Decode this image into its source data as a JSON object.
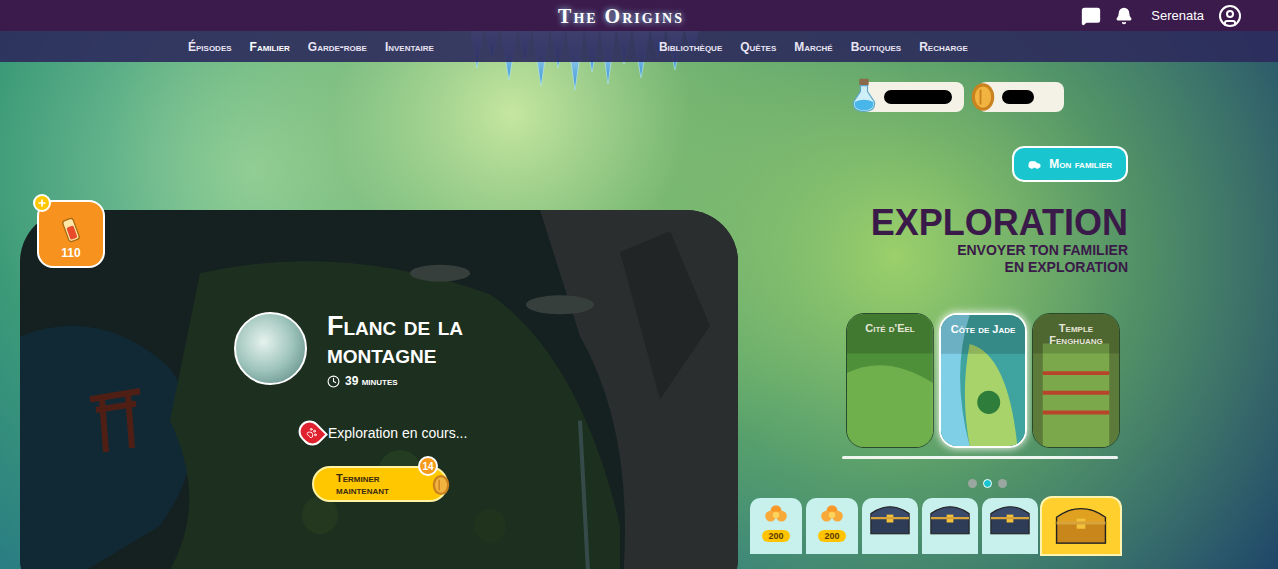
{
  "header": {
    "title": "The Origins",
    "user": "Serenata"
  },
  "nav": {
    "left": [
      {
        "label": "Épisodes",
        "selected": false
      },
      {
        "label": "Familier",
        "selected": true
      },
      {
        "label": "Garde-robe",
        "selected": false
      },
      {
        "label": "Inventaire",
        "selected": false
      }
    ],
    "right": [
      {
        "label": "Bibliothèque",
        "selected": false
      },
      {
        "label": "Quêtes",
        "selected": false
      },
      {
        "label": "Marché",
        "selected": false
      },
      {
        "label": "Boutiques",
        "selected": false
      },
      {
        "label": "Recharge",
        "selected": false
      }
    ]
  },
  "currencies": [
    {
      "kind": "mana"
    },
    {
      "kind": "gold"
    }
  ],
  "energy": {
    "value": "110"
  },
  "exploration_card": {
    "place": "Flanc de la montagne",
    "duration": "39 minutes",
    "status": "Exploration en cours...",
    "button": "Terminer maintenant",
    "cost": "14"
  },
  "pet_button": "Mon familier",
  "heading": "EXPLORATION",
  "subheading": [
    "ENVOYER TON FAMILIER",
    "EN EXPLORATION"
  ],
  "regions": [
    {
      "name": "Cité d'Eel",
      "selected": false,
      "color": "#4e8f3a"
    },
    {
      "name": "Côte de Jade",
      "selected": true,
      "color": "#3fa3a0"
    },
    {
      "name": "Temple Fenghuang",
      "selected": false,
      "color": "#5c7a3a"
    }
  ],
  "pager": [
    {
      "selected": false
    },
    {
      "selected": true
    },
    {
      "selected": false
    }
  ],
  "rewards": [
    {
      "kind": "tile",
      "label": "200",
      "selected": false
    },
    {
      "kind": "tile",
      "label": "200",
      "selected": false
    },
    {
      "kind": "chest",
      "selected": false
    },
    {
      "kind": "chest",
      "selected": false
    },
    {
      "kind": "chest",
      "selected": false
    },
    {
      "kind": "bigchest",
      "selected": true
    }
  ]
}
